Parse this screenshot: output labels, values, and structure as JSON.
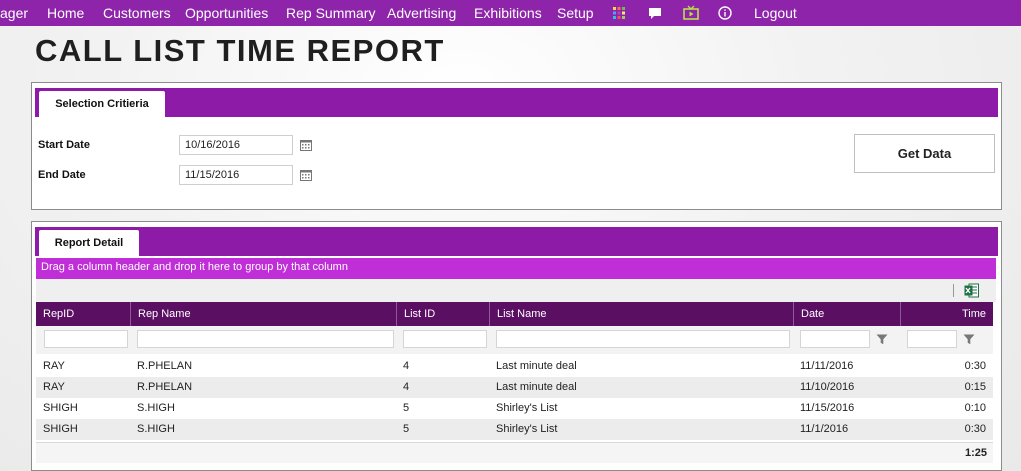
{
  "nav": {
    "items": [
      "ager",
      "Home",
      "Customers",
      "Opportunities",
      "Rep Summary",
      "Advertising",
      "Exhibitions",
      "Setup"
    ],
    "icons": [
      "grid-icon",
      "chat-icon",
      "tv-icon",
      "info-icon"
    ],
    "logout": "Logout",
    "colors": {
      "nav_bg": "#8e24aa",
      "icon_accent": "#b8e04a"
    }
  },
  "page": {
    "title": "CALL LIST TIME REPORT"
  },
  "selection": {
    "tab_label": "Selection Critieria",
    "start_label": "Start Date",
    "start_value": "10/16/2016",
    "end_label": "End Date",
    "end_value": "11/15/2016",
    "get_data_label": "Get Data"
  },
  "report": {
    "tab_label": "Report Detail",
    "group_hint": "Drag a column header and drop it here to group by that column",
    "columns": [
      "RepID",
      "Rep Name",
      "List ID",
      "List Name",
      "Date",
      "Time"
    ],
    "rows": [
      [
        "RAY",
        "R.PHELAN",
        "4",
        "Last minute deal",
        "11/11/2016",
        "0:30"
      ],
      [
        "RAY",
        "R.PHELAN",
        "4",
        "Last minute deal",
        "11/10/2016",
        "0:15"
      ],
      [
        "SHIGH",
        "S.HIGH",
        "5",
        "Shirley's List",
        "11/15/2016",
        "0:10"
      ],
      [
        "SHIGH",
        "S.HIGH",
        "5",
        "Shirley's List",
        "11/1/2016",
        "0:30"
      ]
    ],
    "total_time": "1:25"
  }
}
